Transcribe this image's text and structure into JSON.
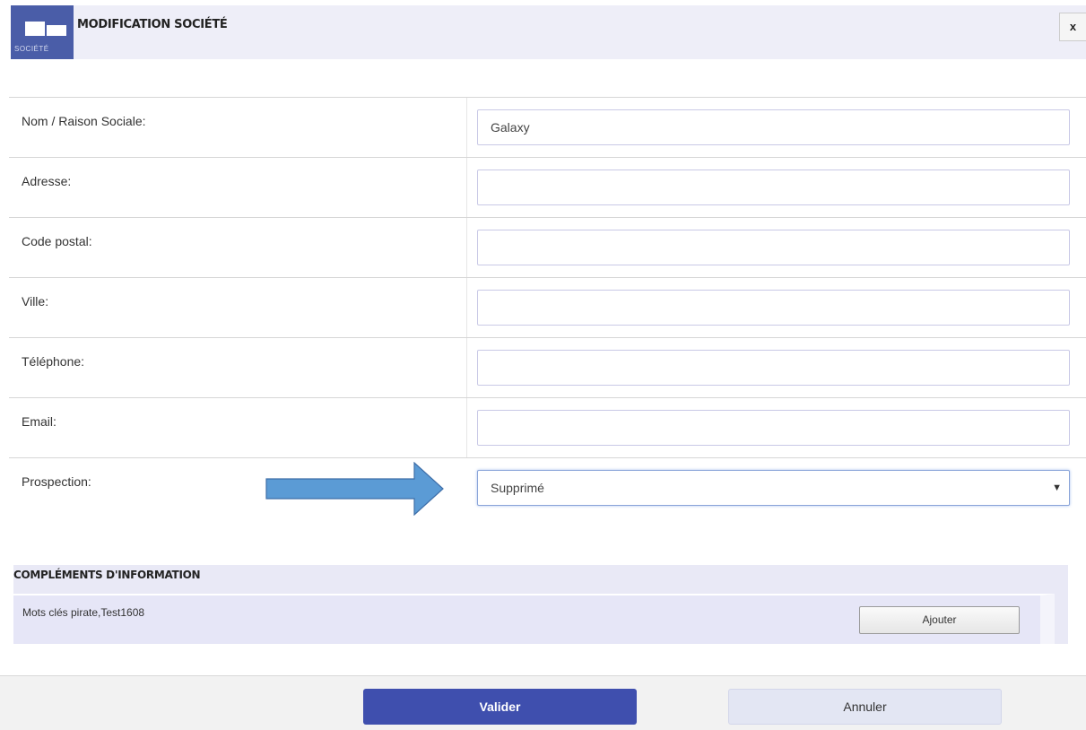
{
  "header": {
    "logo_text": "SOCIÉTÉ",
    "title": "MODIFICATION SOCIÉTÉ",
    "close_label": "x"
  },
  "form": {
    "fields": [
      {
        "label": "Nom / Raison Sociale:",
        "value": "Galaxy"
      },
      {
        "label": "Adresse:",
        "value": ""
      },
      {
        "label": "Code postal:",
        "value": ""
      },
      {
        "label": "Ville:",
        "value": ""
      },
      {
        "label": "Téléphone:",
        "value": ""
      },
      {
        "label": "Email:",
        "value": ""
      }
    ],
    "prospection": {
      "label": "Prospection:",
      "selected": "Supprimé"
    }
  },
  "annotation": {
    "arrow_color": "#5b9bd5"
  },
  "complements": {
    "title": "COMPLÉMENTS D'INFORMATION",
    "keywords": "Mots clés pirate,Test1608",
    "add_label": "Ajouter"
  },
  "footer": {
    "submit_label": "Valider",
    "cancel_label": "Annuler"
  },
  "colors": {
    "accent": "#3f4fae",
    "header_bg": "#eeeef8"
  }
}
